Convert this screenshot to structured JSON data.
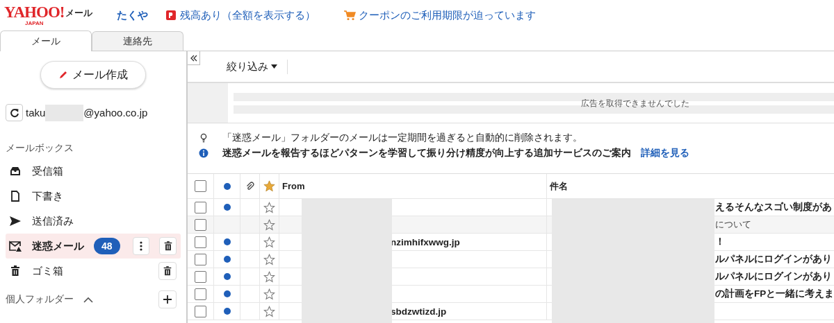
{
  "header": {
    "logo": {
      "brand": "YAHOO!",
      "region": "JAPAN",
      "service": "メール"
    },
    "user_name": "たくや",
    "balance_link": "残高あり（全額を表示する）",
    "coupon_link": "クーポンのご利用期限が迫っています"
  },
  "tabs": [
    {
      "label": "メール",
      "selected": true
    },
    {
      "label": "連絡先",
      "selected": false
    }
  ],
  "sidebar": {
    "compose_button": "メール作成",
    "account": {
      "prefix": "taku",
      "suffix": "@yahoo.co.jp"
    },
    "mailbox_heading": "メールボックス",
    "folders": [
      {
        "kind": "inbox",
        "label": "受信箱",
        "selected": false
      },
      {
        "kind": "drafts",
        "label": "下書き",
        "selected": false
      },
      {
        "kind": "sent",
        "label": "送信済み",
        "selected": false
      },
      {
        "kind": "spam",
        "label": "迷惑メール",
        "selected": true,
        "count": "48"
      },
      {
        "kind": "trash",
        "label": "ゴミ箱",
        "selected": false
      }
    ],
    "personal_heading": "個人フォルダー",
    "personal_expanded": true
  },
  "toolbar": {
    "filter": "絞り込み"
  },
  "ad": {
    "message": "広告を取得できませんでした"
  },
  "notices": [
    {
      "kind": "tip",
      "text": "「迷惑メール」フォルダーのメールは一定期間を過ぎると自動的に削除されます。"
    },
    {
      "kind": "info",
      "text": "迷惑メールを報告するほどパターンを学習して振り分け精度が向上する追加サービスのご案内",
      "link": "詳細を見る"
    }
  ],
  "table": {
    "select_all_checked": false,
    "columns": [
      "From",
      "件名"
    ],
    "rows": [
      {
        "unread": true,
        "checked": false,
        "starred": false,
        "from": "",
        "subject": "えるそんなスゴい制度があ"
      },
      {
        "unread": false,
        "checked": false,
        "starred": false,
        "from": "",
        "subject": "について"
      },
      {
        "unread": true,
        "checked": false,
        "starred": false,
        "from": "nzimhifxwwg.jp",
        "subject": "！"
      },
      {
        "unread": true,
        "checked": false,
        "starred": false,
        "from": "",
        "subject": "ルパネルにログインがあり"
      },
      {
        "unread": true,
        "checked": false,
        "starred": false,
        "from": "",
        "subject": "ルパネルにログインがあり"
      },
      {
        "unread": true,
        "checked": false,
        "starred": false,
        "from": "",
        "subject": "の計画をFPと一緒に考えま"
      },
      {
        "unread": true,
        "checked": false,
        "starred": false,
        "from": "sbdzwtizd.jp",
        "subject": ""
      }
    ]
  }
}
